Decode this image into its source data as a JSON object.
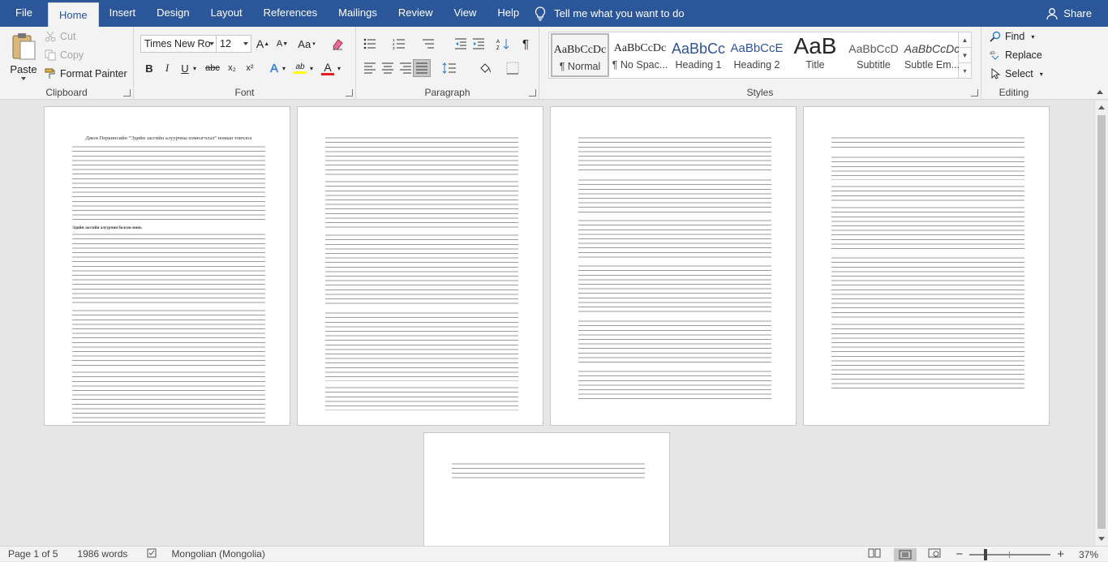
{
  "tabs": [
    {
      "label": "File"
    },
    {
      "label": "Home"
    },
    {
      "label": "Insert"
    },
    {
      "label": "Design"
    },
    {
      "label": "Layout"
    },
    {
      "label": "References"
    },
    {
      "label": "Mailings"
    },
    {
      "label": "Review"
    },
    {
      "label": "View"
    },
    {
      "label": "Help"
    }
  ],
  "tell_me": "Tell me what you want to do",
  "share": "Share",
  "clipboard": {
    "label": "Clipboard",
    "paste": "Paste",
    "cut": "Cut",
    "copy": "Copy",
    "format_painter": "Format Painter"
  },
  "font": {
    "label": "Font",
    "family": "Times New Ro",
    "size": "12",
    "grow": "A",
    "shrink": "A",
    "change_case": "Aa",
    "bold": "B",
    "italic": "I",
    "underline": "U",
    "strike": "abc",
    "subscript": "x₂",
    "superscript": "x²",
    "effects": "A",
    "highlight": "ab",
    "color": "A"
  },
  "paragraph": {
    "label": "Paragraph"
  },
  "styles": {
    "label": "Styles",
    "items": [
      {
        "sample": "AaBbCcDc",
        "name": "¶ Normal"
      },
      {
        "sample": "AaBbCcDc",
        "name": "¶ No Spac..."
      },
      {
        "sample": "AaBbCc",
        "name": "Heading 1"
      },
      {
        "sample": "AaBbCcE",
        "name": "Heading 2"
      },
      {
        "sample": "AaB",
        "name": "Title"
      },
      {
        "sample": "AaBbCcD",
        "name": "Subtitle"
      },
      {
        "sample": "AaBbCcDc",
        "name": "Subtle Em..."
      }
    ]
  },
  "editing": {
    "label": "Editing",
    "find": "Find",
    "replace": "Replace",
    "select": "Select"
  },
  "pages": {
    "p1_title": "Джон Перкинсийн “Эдийн засгийн алуурчны нэмнэгчлэл” номын товчлол",
    "p1_heading": "Эдийн засгийн алуурчин болсон минь"
  },
  "status": {
    "page": "Page 1 of 5",
    "words": "1986 words",
    "language": "Mongolian (Mongolia)",
    "zoom": "37%"
  }
}
